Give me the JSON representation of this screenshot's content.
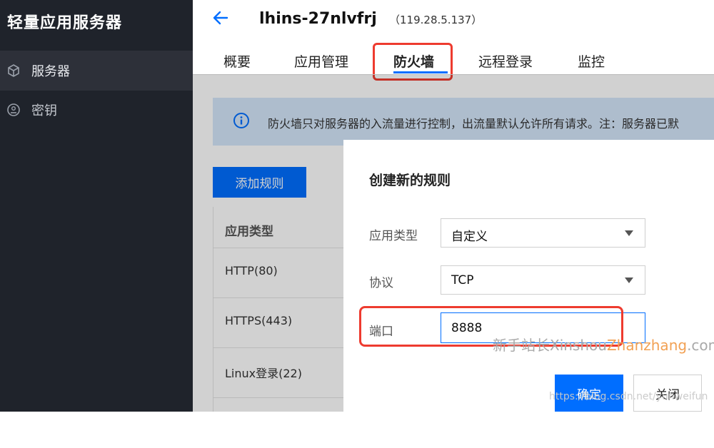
{
  "sidebar": {
    "title": "轻量应用服务器",
    "items": [
      {
        "label": "服务器",
        "icon": "cube-icon"
      },
      {
        "label": "密钥",
        "icon": "key-icon"
      }
    ]
  },
  "header": {
    "instance_name": "lhins-27nlvfrj",
    "ip": "（119.28.5.137）"
  },
  "tabs": [
    {
      "label": "概要"
    },
    {
      "label": "应用管理"
    },
    {
      "label": "防火墙"
    },
    {
      "label": "远程登录"
    },
    {
      "label": "监控"
    }
  ],
  "active_tab": "防火墙",
  "notice": {
    "text": "防火墙只对服务器的入流量进行控制，出流量默认允许所有请求。注：服务器已默"
  },
  "add_rule_button": "添加规则",
  "table": {
    "header": "应用类型",
    "rows": [
      "HTTP(80)",
      "HTTPS(443)",
      "Linux登录(22)"
    ]
  },
  "modal": {
    "title": "创建新的规则",
    "app_type_label": "应用类型",
    "app_type_value": "自定义",
    "protocol_label": "协议",
    "protocol_value": "TCP",
    "port_label": "端口",
    "port_value": "8888",
    "ok_label": "确定",
    "close_label": "关闭"
  },
  "watermarks": {
    "site_prefix": "新手站长Xinshou",
    "site_accent": "Zhanzhang",
    "site_suffix": ".com",
    "blog": "https://blog.csdn.net/yunweifun"
  },
  "colors": {
    "accent": "#006eff",
    "sidebar_bg": "#1f232b",
    "highlight_red": "#ee3b2f",
    "notice_bg": "#d5e7fb"
  }
}
